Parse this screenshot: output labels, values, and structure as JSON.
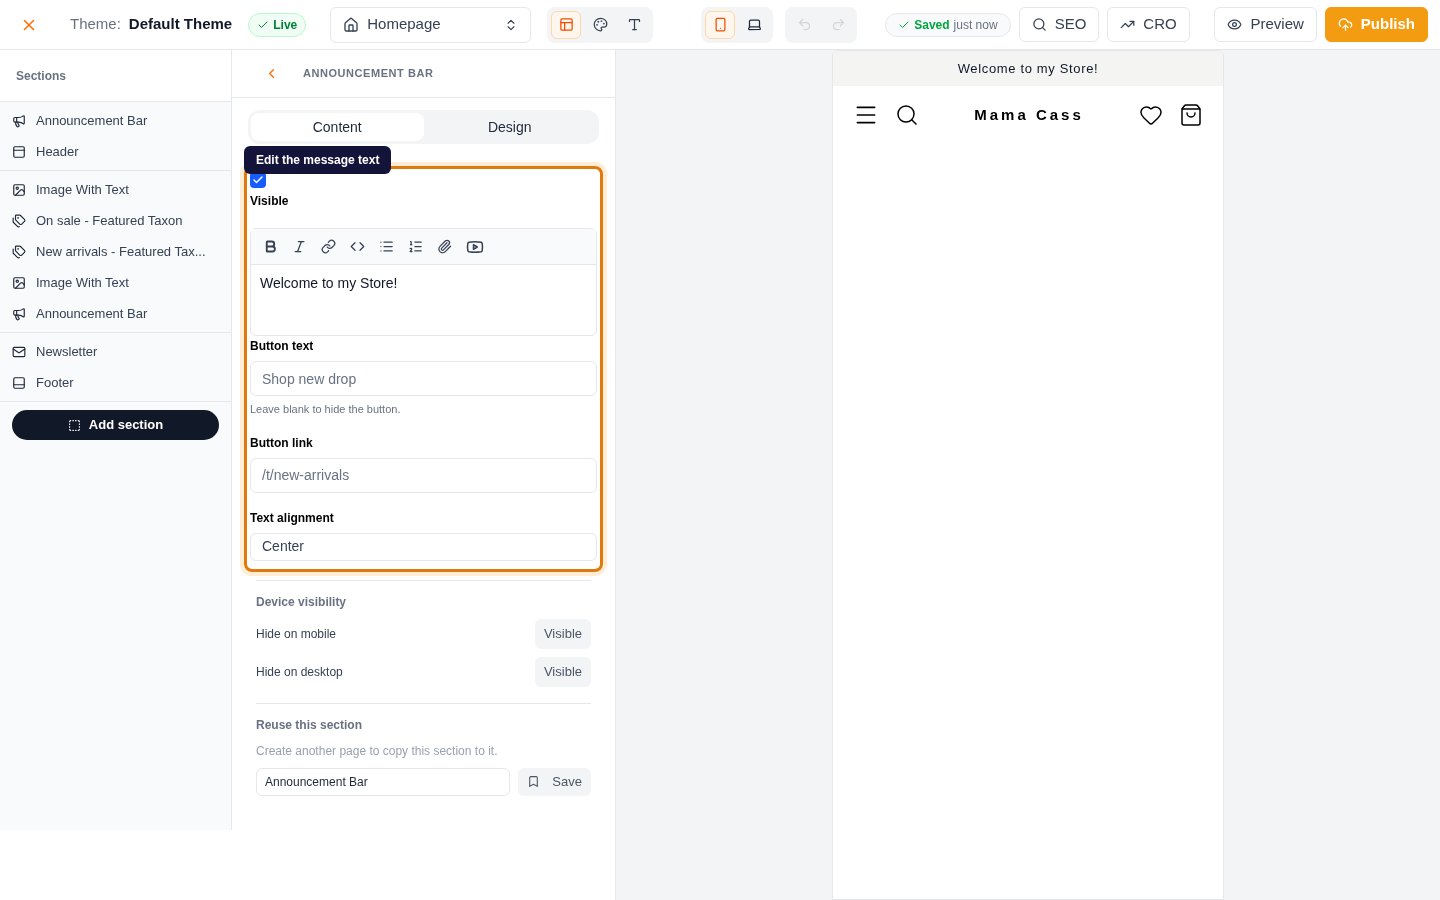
{
  "topbar": {
    "theme_label": "Theme:",
    "theme_name": "Default Theme",
    "status_badge": "Live",
    "page_select": "Homepage",
    "editor_modes": [
      {
        "kind": "sections",
        "selected": true
      },
      {
        "kind": "colors",
        "selected": false
      },
      {
        "kind": "typography",
        "selected": false
      }
    ],
    "devices": [
      {
        "kind": "mobile",
        "selected": true
      },
      {
        "kind": "desktop",
        "selected": false
      }
    ],
    "history": [
      {
        "kind": "undo",
        "disabled": true
      },
      {
        "kind": "redo",
        "disabled": true
      }
    ],
    "save_status": {
      "state": "Saved",
      "time": "just now"
    },
    "buttons": [
      {
        "kind": "seo",
        "label": "SEO"
      },
      {
        "kind": "cro",
        "label": "CRO"
      },
      {
        "kind": "preview",
        "label": "Preview"
      },
      {
        "kind": "publish",
        "label": "Publish"
      }
    ]
  },
  "sidebar": {
    "title": "Sections",
    "groups": [
      [
        {
          "kind": "announcement",
          "label": "Announcement Bar"
        },
        {
          "kind": "header",
          "label": "Header"
        }
      ],
      [
        {
          "kind": "image",
          "label": "Image With Text"
        },
        {
          "kind": "tag",
          "label": "On sale - Featured Taxon"
        },
        {
          "kind": "tag",
          "label": "New arrivals - Featured Tax..."
        },
        {
          "kind": "image",
          "label": "Image With Text"
        },
        {
          "kind": "announcement",
          "label": "Announcement Bar"
        }
      ],
      [
        {
          "kind": "newsletter",
          "label": "Newsletter"
        },
        {
          "kind": "footer",
          "label": "Footer"
        }
      ]
    ],
    "add_button": "Add section"
  },
  "editor": {
    "title": "ANNOUNCEMENT BAR",
    "tabs": [
      {
        "label": "Content",
        "selected": true
      },
      {
        "label": "Design",
        "selected": false
      }
    ],
    "tooltip": "Edit the message text",
    "visible": {
      "label": "Visible",
      "checked": true
    },
    "message": {
      "value": "Welcome to my Store!"
    },
    "fields": [
      {
        "label": "Button text",
        "placeholder": "Shop new drop",
        "hint": "Leave blank to hide the button."
      },
      {
        "label": "Button link",
        "placeholder": "/t/new-arrivals"
      },
      {
        "label": "Text alignment",
        "value": "Center"
      }
    ],
    "device_visibility": {
      "title": "Device visibility",
      "rows": [
        {
          "label": "Hide on mobile",
          "value": "Visible"
        },
        {
          "label": "Hide on desktop",
          "value": "Visible"
        }
      ]
    },
    "reuse": {
      "title": "Reuse this section",
      "description": "Create another page to copy this section to it.",
      "name": "Announcement Bar",
      "save": "Save"
    }
  },
  "preview": {
    "announcement": "Welcome to my Store!",
    "store_name": "Mama Cass"
  }
}
